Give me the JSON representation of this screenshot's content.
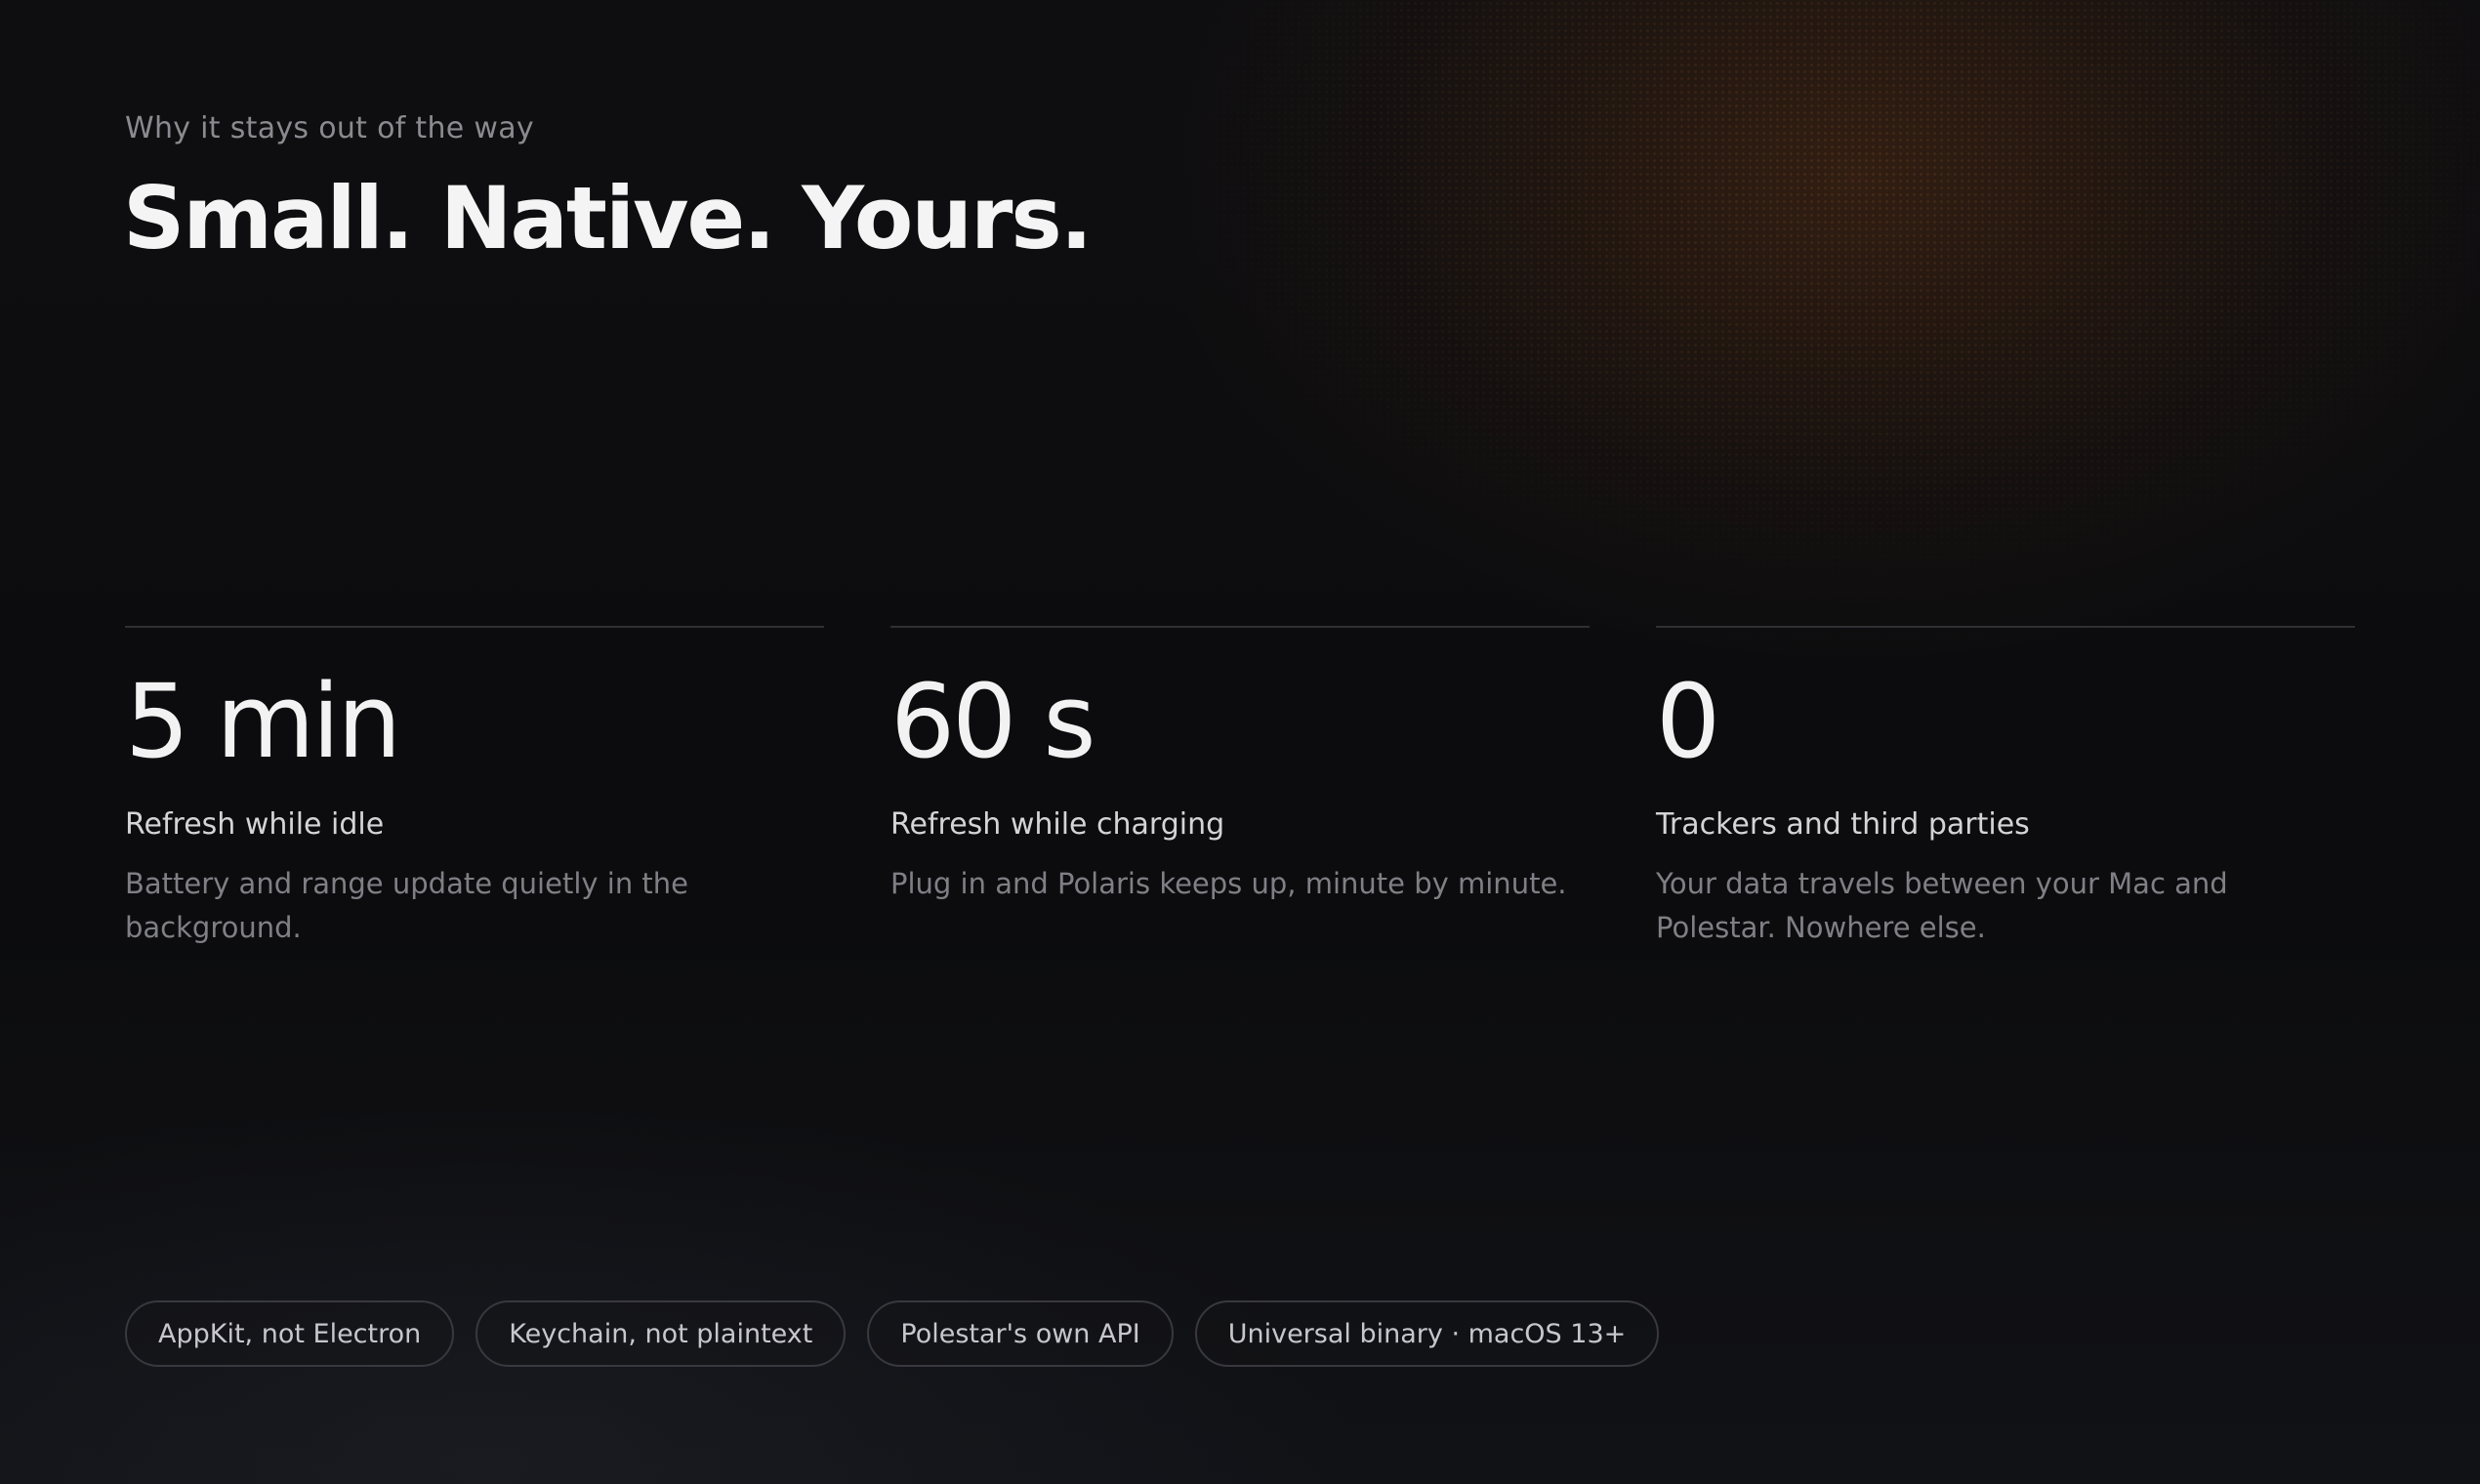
{
  "header": {
    "eyebrow": "Why it stays out of the way",
    "title": "Small. Native. Yours."
  },
  "stats": [
    {
      "value": "5 min",
      "label": "Refresh while idle",
      "description": "Battery and range update quietly in the background."
    },
    {
      "value": "60 s",
      "label": "Refresh while charging",
      "description": "Plug in and Polaris keeps up, minute by minute."
    },
    {
      "value": "0",
      "label": "Trackers and third parties",
      "description": "Your data travels between your Mac and Polestar. Nowhere else."
    }
  ],
  "tags": [
    "AppKit, not Electron",
    "Keychain, not plaintext",
    "Polestar's own API",
    "Universal binary · macOS 13+"
  ],
  "colors": {
    "background": "#0d0d10",
    "glow": "#783e16",
    "headline": "#f4f4f4",
    "muted": "#7f7f86"
  }
}
